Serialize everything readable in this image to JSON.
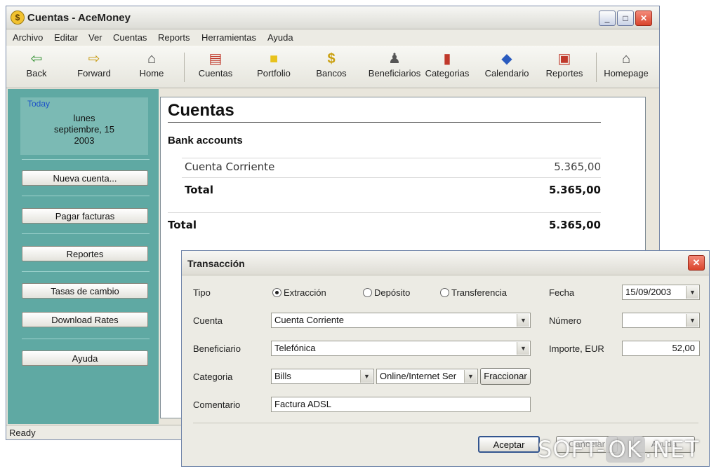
{
  "window": {
    "title": "Cuentas - AceMoney",
    "app_icon": "$"
  },
  "menu": [
    "Archivo",
    "Editar",
    "Ver",
    "Cuentas",
    "Reports",
    "Herramientas",
    "Ayuda"
  ],
  "toolbar": [
    {
      "label": "Back",
      "icon": "back-arrow-icon",
      "glyph": "⇦",
      "color": "#2f8f2f"
    },
    {
      "label": "Forward",
      "icon": "forward-arrow-icon",
      "glyph": "⇨",
      "color": "#c79a10"
    },
    {
      "label": "Home",
      "icon": "home-icon",
      "glyph": "⌂",
      "color": "#444444"
    },
    {
      "label": "Cuentas",
      "icon": "accounts-icon",
      "glyph": "▤",
      "color": "#c0392b"
    },
    {
      "label": "Portfolio",
      "icon": "folder-icon",
      "glyph": "■",
      "color": "#e8c21c"
    },
    {
      "label": "Bancos",
      "icon": "bank-coin-icon",
      "glyph": "$",
      "color": "#caa010"
    },
    {
      "label": "Beneficiarios",
      "icon": "payee-icon",
      "glyph": "♟",
      "color": "#555555"
    },
    {
      "label": "Categorias",
      "icon": "categories-chart-icon",
      "glyph": "▮",
      "color": "#c0392b"
    },
    {
      "label": "Calendario",
      "icon": "calendar-icon",
      "glyph": "◆",
      "color": "#2a5bbf"
    },
    {
      "label": "Reportes",
      "icon": "reports-icon",
      "glyph": "▣",
      "color": "#c0392b"
    },
    {
      "label": "Homepage",
      "icon": "homepage-icon",
      "glyph": "⌂",
      "color": "#444444"
    }
  ],
  "sidebar": {
    "today_label": "Today",
    "date_line1": "lunes",
    "date_line2": "septiembre, 15",
    "date_line3": "2003",
    "buttons": [
      "Nueva cuenta...",
      "Pagar facturas",
      "Reportes",
      "Tasas de cambio",
      "Download Rates",
      "Ayuda"
    ]
  },
  "main": {
    "title": "Cuentas",
    "section": "Bank accounts",
    "account_name": "Cuenta Corriente",
    "account_value": "5.365,00",
    "subtotal_label": "Total",
    "subtotal_value": "5.365,00",
    "grand_total_label": "Total",
    "grand_total_value": "5.365,00"
  },
  "status": "Ready",
  "dialog": {
    "title": "Transacción",
    "tipo_label": "Tipo",
    "radio_options": [
      "Extracción",
      "Depósito",
      "Transferencia"
    ],
    "radio_selected": "Extracción",
    "cuenta_label": "Cuenta",
    "cuenta_value": "Cuenta Corriente",
    "beneficiario_label": "Beneficiario",
    "beneficiario_value": "Telefónica",
    "categoria_label": "Categoria",
    "categoria_value": "Bills",
    "subcategoria_value": "Online/Internet Ser",
    "fraccionar_label": "Fraccionar",
    "comentario_label": "Comentario",
    "comentario_value": "Factura ADSL",
    "fecha_label": "Fecha",
    "fecha_value": "15/09/2003",
    "numero_label": "Número",
    "numero_value": "",
    "importe_label": "Importe, EUR",
    "importe_value": "52,00",
    "aceptar_label": "Aceptar",
    "cancelar_label": "Cancelar",
    "ayuda_label": "Ayuda"
  },
  "watermark": {
    "part1": "SOFT-",
    "part2": "OK",
    "part3": ".NET"
  }
}
